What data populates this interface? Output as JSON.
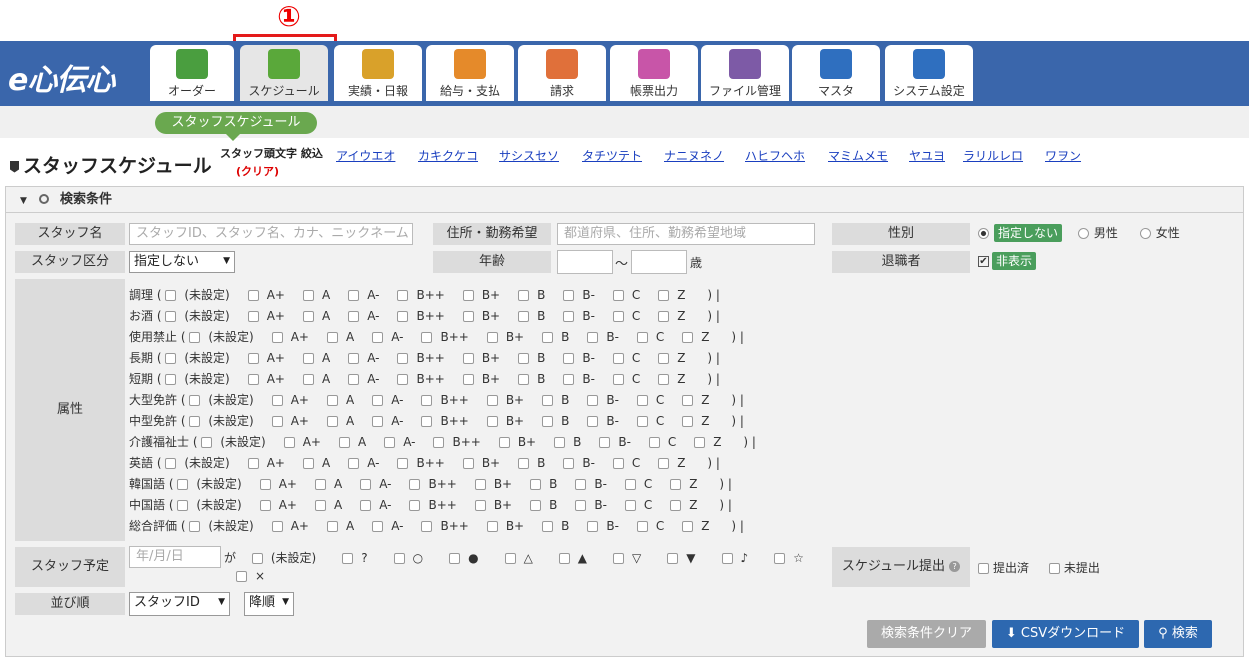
{
  "annotation": {
    "marker": "①"
  },
  "header": {
    "logo": "e心伝心",
    "tabs": [
      {
        "label": "オーダー",
        "icon": "handshake-icon",
        "color": "#4a9e3f"
      },
      {
        "label": "スケジュール",
        "icon": "calendar-icon",
        "color": "#5aa83a"
      },
      {
        "label": "実績・日報",
        "icon": "book-icon",
        "color": "#d9a12a"
      },
      {
        "label": "給与・支払",
        "icon": "payroll-icon",
        "color": "#e58a2a"
      },
      {
        "label": "請求",
        "icon": "billing-icon",
        "color": "#e0703a"
      },
      {
        "label": "帳票出力",
        "icon": "papers-icon",
        "color": "#c855a8"
      },
      {
        "label": "ファイル管理",
        "icon": "folder-icon",
        "color": "#7d5aa6"
      },
      {
        "label": "マスタ",
        "icon": "database-icon",
        "color": "#2f6fbf"
      },
      {
        "label": "システム設定",
        "icon": "monitor-settings-icon",
        "color": "#2f6fbf"
      }
    ]
  },
  "subnav": {
    "pill": "スタッフスケジュール"
  },
  "page": {
    "title": "スタッフスケジュール"
  },
  "kana_filter": {
    "label": "スタッフ頭文字 絞込",
    "clear": "(クリア)",
    "items": [
      "アイウエオ",
      "カキクケコ",
      "サシスセソ",
      "タチツテト",
      "ナニヌネノ",
      "ハヒフヘホ",
      "マミムメモ",
      "ヤユヨ",
      "ラリルレロ",
      "ワヲン"
    ]
  },
  "search": {
    "header": "検索条件",
    "staff_name": {
      "label": "スタッフ名",
      "placeholder": "スタッフID、スタッフ名、カナ、ニックネーム"
    },
    "address": {
      "label": "住所・勤務希望",
      "placeholder": "都道府県、住所、勤務希望地域"
    },
    "gender": {
      "label": "性別",
      "options": [
        "指定しない",
        "男性",
        "女性"
      ]
    },
    "staff_type": {
      "label": "スタッフ区分",
      "value": "指定しない"
    },
    "age": {
      "label": "年齢",
      "sep": "〜",
      "unit": "歳"
    },
    "retired": {
      "label": "退職者",
      "value": "非表示"
    },
    "attributes": {
      "label": "属性",
      "rows": [
        {
          "name": "調理",
          "opts": [
            "(未設定)",
            "A+",
            "A",
            "A-",
            "B++",
            "B+",
            "B",
            "B-",
            "C",
            "Z"
          ]
        },
        {
          "name": "お酒",
          "opts": [
            "(未設定)",
            "A+",
            "A",
            "A-",
            "B++",
            "B+",
            "B",
            "B-",
            "C",
            "Z"
          ]
        },
        {
          "name": "使用禁止",
          "opts": [
            "(未設定)",
            "A+",
            "A",
            "A-",
            "B++",
            "B+",
            "B",
            "B-",
            "C",
            "Z"
          ]
        },
        {
          "name": "長期",
          "opts": [
            "(未設定)",
            "A+",
            "A",
            "A-",
            "B++",
            "B+",
            "B",
            "B-",
            "C",
            "Z"
          ]
        },
        {
          "name": "短期",
          "opts": [
            "(未設定)",
            "A+",
            "A",
            "A-",
            "B++",
            "B+",
            "B",
            "B-",
            "C",
            "Z"
          ]
        },
        {
          "name": "大型免許",
          "opts": [
            "(未設定)",
            "A+",
            "A",
            "A-",
            "B++",
            "B+",
            "B",
            "B-",
            "C",
            "Z"
          ]
        },
        {
          "name": "中型免許",
          "opts": [
            "(未設定)",
            "A+",
            "A",
            "A-",
            "B++",
            "B+",
            "B",
            "B-",
            "C",
            "Z"
          ]
        },
        {
          "name": "介護福祉士",
          "opts": [
            "(未設定)",
            "A+",
            "A",
            "A-",
            "B++",
            "B+",
            "B",
            "B-",
            "C",
            "Z"
          ]
        },
        {
          "name": "英語",
          "opts": [
            "(未設定)",
            "A+",
            "A",
            "A-",
            "B++",
            "B+",
            "B",
            "B-",
            "C",
            "Z"
          ]
        },
        {
          "name": "韓国語",
          "opts": [
            "(未設定)",
            "A+",
            "A",
            "A-",
            "B++",
            "B+",
            "B",
            "B-",
            "C",
            "Z"
          ]
        },
        {
          "name": "中国語",
          "opts": [
            "(未設定)",
            "A+",
            "A",
            "A-",
            "B++",
            "B+",
            "B",
            "B-",
            "C",
            "Z"
          ]
        },
        {
          "name": "総合評価",
          "opts": [
            "(未設定)",
            "A+",
            "A",
            "A-",
            "B++",
            "B+",
            "B",
            "B-",
            "C",
            "Z"
          ]
        }
      ]
    },
    "staff_plan": {
      "label": "スタッフ予定",
      "placeholder": "年/月/日",
      "ga": "が",
      "opts": [
        "(未設定)",
        "?",
        "○",
        "●",
        "△",
        "▲",
        "▽",
        "▼",
        "♪",
        "☆",
        "×"
      ]
    },
    "schedule_submit": {
      "label": "スケジュール提出",
      "opts": [
        "提出済",
        "未提出"
      ]
    },
    "sort": {
      "label": "並び順",
      "field": "スタッフID",
      "order": "降順"
    },
    "buttons": {
      "clear": "検索条件クリア",
      "csv": "CSVダウンロード",
      "search": "検索"
    }
  }
}
